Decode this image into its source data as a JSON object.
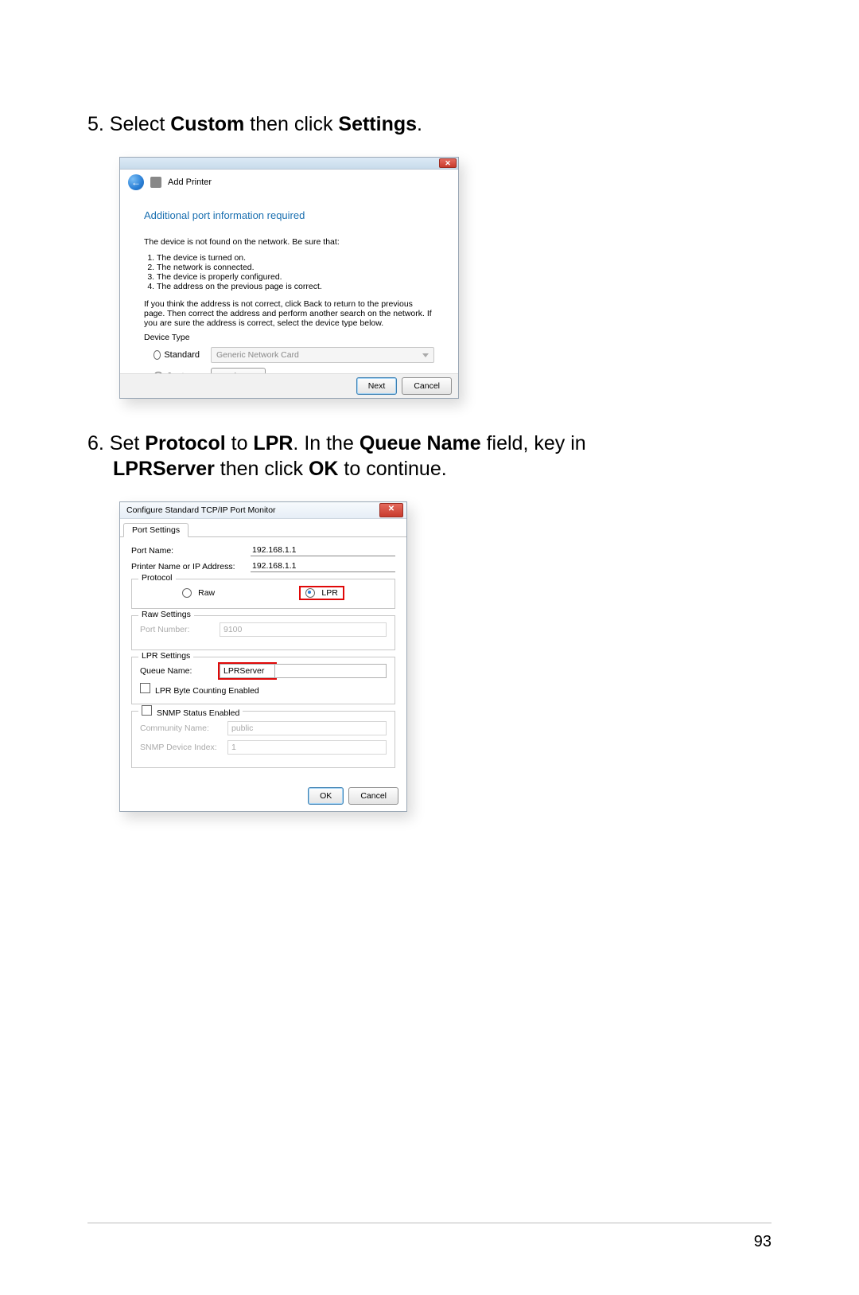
{
  "steps": {
    "s5_prefix": "5.  Select ",
    "s5_bold1": "Custom",
    "s5_mid": " then click ",
    "s5_bold2": "Settings",
    "s5_suffix": ".",
    "s6_prefix": "6.  Set ",
    "s6_b1": "Protocol",
    "s6_m1": " to ",
    "s6_b2": "LPR",
    "s6_m2": ". In the ",
    "s6_b3": "Queue Name",
    "s6_m3": " field, key in ",
    "s6_line2_b1": "LPRServer",
    "s6_line2_m1": " then click ",
    "s6_line2_b2": "OK",
    "s6_line2_m2": " to continue."
  },
  "dlg1": {
    "close_glyph": "✕",
    "back_glyph": "←",
    "header_title": "Add Printer",
    "subtitle": "Additional port information required",
    "msg": "The device is not found on the network.  Be sure that:",
    "list": [
      "The device is turned on.",
      "The network is connected.",
      "The device is properly configured.",
      "The address on the previous page is correct."
    ],
    "note": "If you think the address is not correct, click Back to return to the previous page.  Then correct the address and perform another search on the network.  If you are sure the address is correct, select the device type below.",
    "device_type_label": "Device Type",
    "standard_label": "Standard",
    "standard_value": "Generic Network Card",
    "custom_label": "Custom",
    "settings_btn": "Settings...",
    "next_btn": "Next",
    "cancel_btn": "Cancel"
  },
  "dlg2": {
    "title": "Configure Standard TCP/IP Port Monitor",
    "close_glyph": "✕",
    "tab": "Port Settings",
    "port_name_label": "Port Name:",
    "port_name_value": "192.168.1.1",
    "printer_label": "Printer Name or IP Address:",
    "printer_value": "192.168.1.1",
    "protocol_legend": "Protocol",
    "raw_label": "Raw",
    "lpr_label": "LPR",
    "raw_settings_legend": "Raw Settings",
    "port_number_label": "Port Number:",
    "port_number_value": "9100",
    "lpr_settings_legend": "LPR Settings",
    "queue_name_label": "Queue Name:",
    "queue_name_value": "LPRServer",
    "lpr_byte_label": "LPR Byte Counting Enabled",
    "snmp_legend_chk": "SNMP Status Enabled",
    "community_label": "Community Name:",
    "community_value": "public",
    "snmp_index_label": "SNMP Device Index:",
    "snmp_index_value": "1",
    "ok_btn": "OK",
    "cancel_btn": "Cancel"
  },
  "page_number": "93"
}
